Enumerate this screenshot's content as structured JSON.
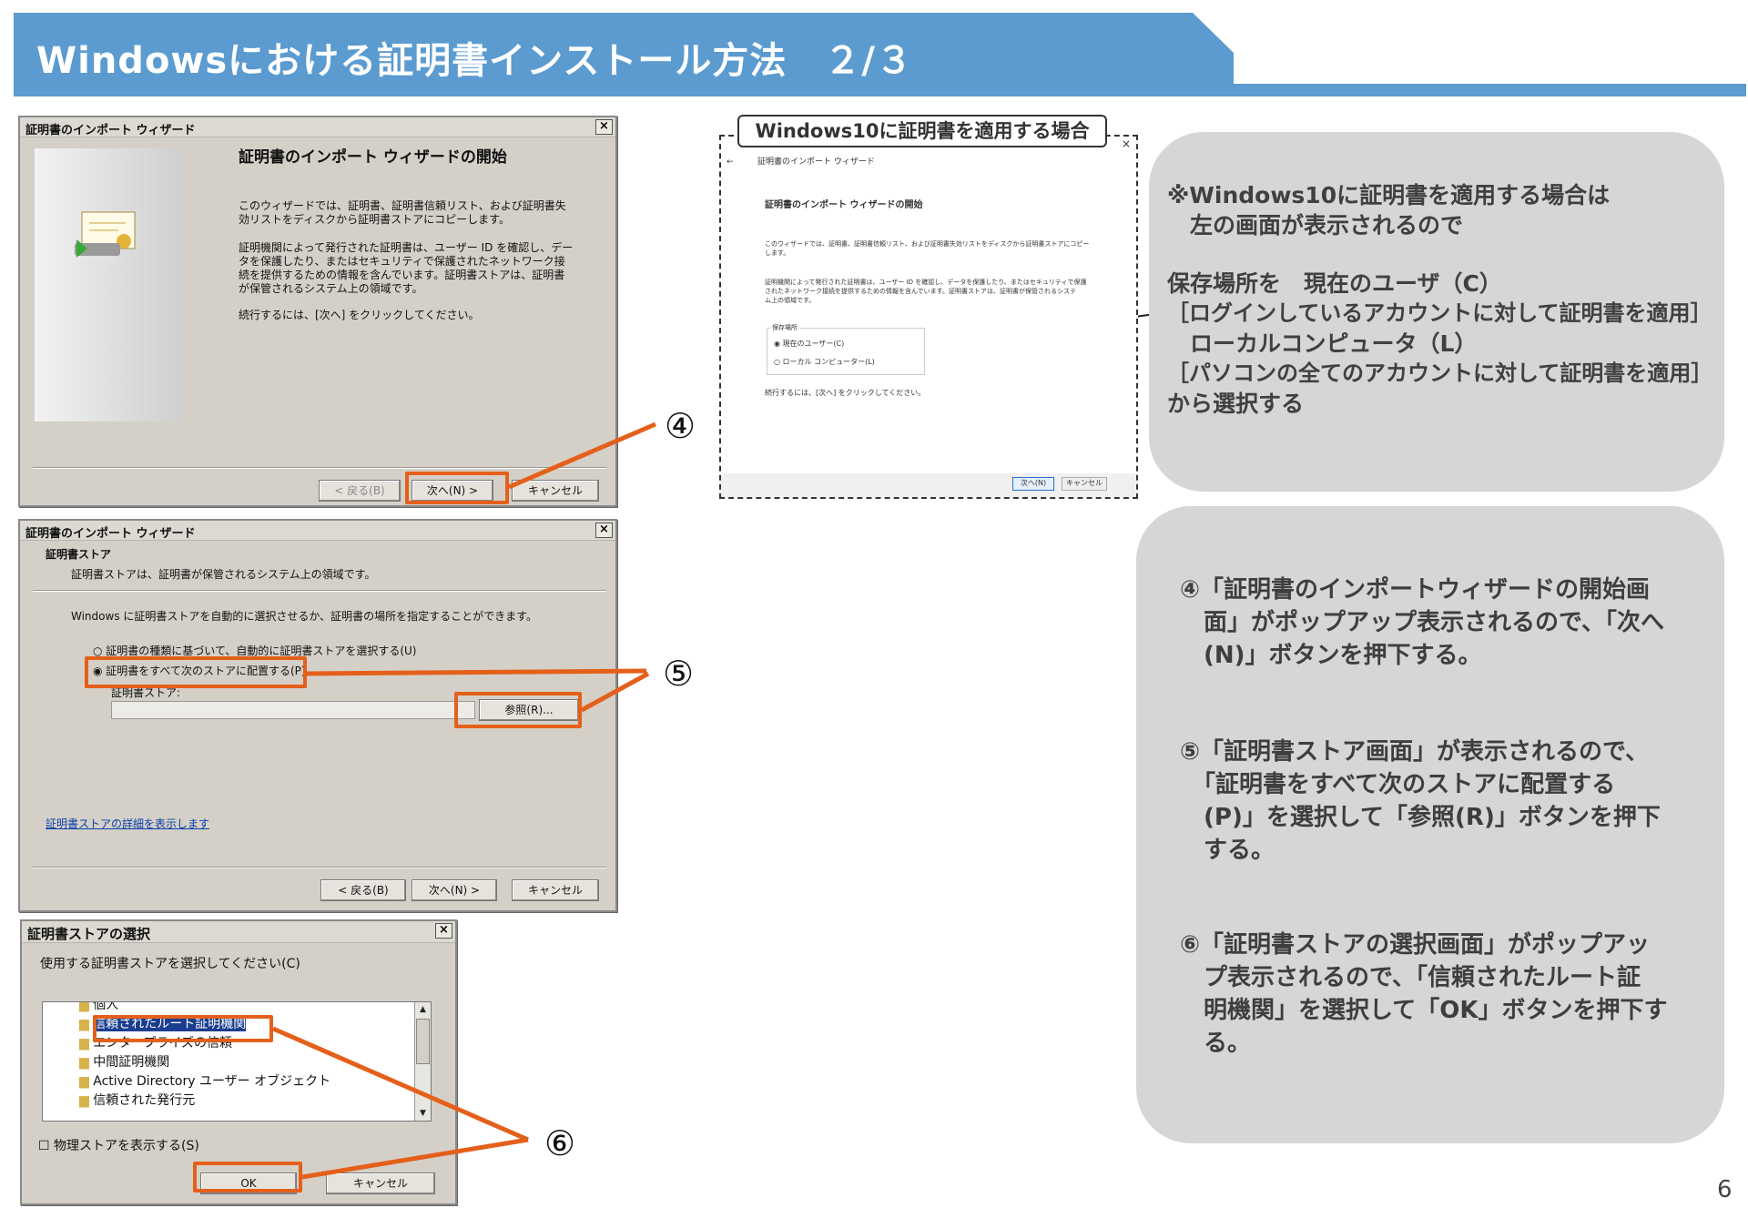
{
  "header": {
    "title": "Windowsにおける証明書インストール方法　２/３",
    "bar_color": "#5b9bd0"
  },
  "page_number": "6",
  "dialog1": {
    "title": "証明書のインポート ウィザード",
    "heading": "証明書のインポート ウィザードの開始",
    "para1": "このウィザードでは、証明書、証明書信頼リスト、および証明書失効リストをディスクから証明書ストアにコピーします。",
    "para2": "証明機関によって発行された証明書は、ユーザー ID を確認し、データを保護したり、またはセキュリティで保護されたネットワーク接続を提供するための情報を含んでいます。証明書ストアは、証明書が保管されるシステム上の領域です。",
    "para3": "続行するには、[次へ] をクリックしてください。",
    "back": "< 戻る(B)",
    "next": "次へ(N) >",
    "cancel": "キャンセル"
  },
  "dialog2": {
    "title": "証明書のインポート ウィザード",
    "section": "証明書ストア",
    "section_desc": "証明書ストアは、証明書が保管されるシステム上の領域です。",
    "prompt": "Windows に証明書ストアを自動的に選択させるか、証明書の場所を指定することができます。",
    "radio_auto": "証明書の種類に基づいて、自動的に証明書ストアを選択する(U)",
    "radio_manual": "証明書をすべて次のストアに配置する(P)",
    "store_label": "証明書ストア:",
    "browse": "参照(R)...",
    "link": "証明書ストアの詳細を表示します",
    "back": "< 戻る(B)",
    "next": "次へ(N) >",
    "cancel": "キャンセル"
  },
  "dialog3": {
    "title": "証明書ストアの選択",
    "prompt": "使用する証明書ストアを選択してください(C)",
    "items": [
      "個人",
      "信頼されたルート証明機関",
      "エンタープライズの信頼",
      "中間証明機関",
      "Active Directory ユーザー オブジェクト",
      "信頼された発行元"
    ],
    "checkbox": "物理ストアを表示する(S)",
    "ok": "OK",
    "cancel": "キャンセル"
  },
  "win10": {
    "label": "Windows10に証明書を適用する場合",
    "title": "証明書のインポート ウィザード",
    "heading": "証明書のインポート ウィザードの開始",
    "para1a": "このウィザードでは、証明書、証明書信頼リスト、および証明書失効リストをディスクから証明書ストアにコピー",
    "para1b": "します。",
    "para2a": "証明機関によって発行された証明書は、ユーザー ID を確認し、データを保護したり、またはセキュリティで保護",
    "para2b": "されたネットワーク接続を提供するための情報を含んでいます。証明書ストアは、証明書が保管されるシステ",
    "para2c": "ム上の領域です。",
    "store_label": "保存場所",
    "opt_user": "現在のユーザー(C)",
    "opt_local": "ローカル コンピューター(L)",
    "continue": "続行するには、[次へ] をクリックしてください。",
    "next": "次へ(N)",
    "cancel": "キャンセル"
  },
  "markers": {
    "m4": "④",
    "m5": "⑤",
    "m6": "⑥"
  },
  "note1": {
    "l1": "※Windows10に証明書を適用する場合は",
    "l2": "　左の画面が表示されるので",
    "l3": "保存場所を　現在のユーザ（C）",
    "l4": "［ログインしているアカウントに対して証明書を適用］",
    "l5": "　ローカルコンピュータ（L）",
    "l6": "［パソコンの全てのアカウントに対して証明書を適用］",
    "l7": "から選択する"
  },
  "steps": {
    "s4": [
      "④「証明書のインポートウィザードの開始画",
      "　面」がポップアップ表示されるので、「次へ",
      "　(N)」ボタンを押下する。"
    ],
    "s5": [
      "⑤「証明書ストア画面」が表示されるので、",
      "　「証明書をすべて次のストアに配置する",
      "　(P)」を選択して「参照(R)」ボタンを押下",
      "　する。"
    ],
    "s6": [
      "⑥「証明書ストアの選択画面」がポップアッ",
      "　プ表示されるので、「信頼されたルート証",
      "　明機関」を選択して「OK」ボタンを押下す",
      "　る。"
    ]
  },
  "colors": {
    "highlight": "#e4601a",
    "bubble": "#d6d6d6"
  }
}
